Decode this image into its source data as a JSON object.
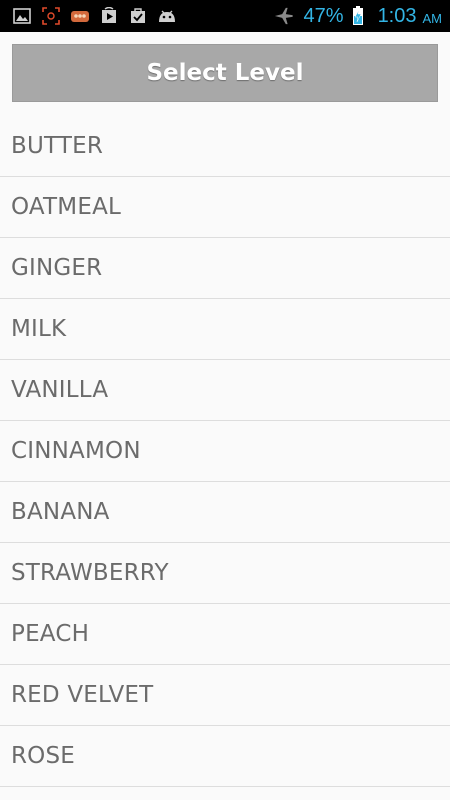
{
  "status_bar": {
    "notification_icons": [
      "gallery-icon",
      "screenshot-icon",
      "chat-icon",
      "play-store-icon",
      "task-icon",
      "android-icon"
    ],
    "airplane_icon": "airplane-icon",
    "battery_percent": "47%",
    "battery_icon": "battery-charging-icon",
    "time": "1:03",
    "ampm": "AM",
    "accent_color": "#33b5e5"
  },
  "header": {
    "button_label": "Select Level",
    "button_color": "#a8a8a8"
  },
  "levels": [
    {
      "label": "BUTTER"
    },
    {
      "label": "OATMEAL"
    },
    {
      "label": "GINGER"
    },
    {
      "label": "MILK"
    },
    {
      "label": "VANILLA"
    },
    {
      "label": "CINNAMON"
    },
    {
      "label": "BANANA"
    },
    {
      "label": "STRAWBERRY"
    },
    {
      "label": "PEACH"
    },
    {
      "label": "RED VELVET"
    },
    {
      "label": "ROSE"
    }
  ]
}
